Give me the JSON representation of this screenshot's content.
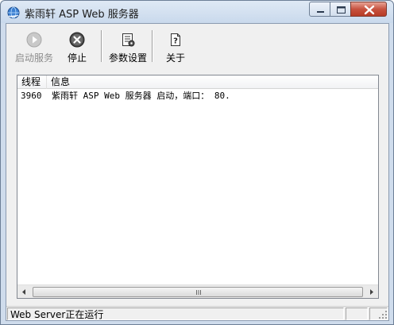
{
  "window": {
    "title": "紫雨轩 ASP Web 服务器",
    "icons": {
      "app": "globe-icon",
      "minimize": "minimize-icon",
      "maximize": "maximize-icon",
      "close": "close-icon"
    }
  },
  "toolbar": {
    "start": {
      "label": "启动服务",
      "icon": "play-icon",
      "enabled": false
    },
    "stop": {
      "label": "停止",
      "icon": "stop-icon"
    },
    "settings": {
      "label": "参数设置",
      "icon": "document-settings-icon"
    },
    "about": {
      "label": "关于",
      "icon": "help-document-icon"
    }
  },
  "log_table": {
    "columns": [
      "线程",
      "信息"
    ],
    "rows": [
      {
        "thread": "3960",
        "info": "紫雨轩 ASP Web 服务器 启动，端口： 80."
      }
    ]
  },
  "scrollbar": {
    "left_arrow": "◂",
    "right_arrow": "▸"
  },
  "status_bar": {
    "text": "Web Server正在运行",
    "pane2": "",
    "pane3": ""
  }
}
